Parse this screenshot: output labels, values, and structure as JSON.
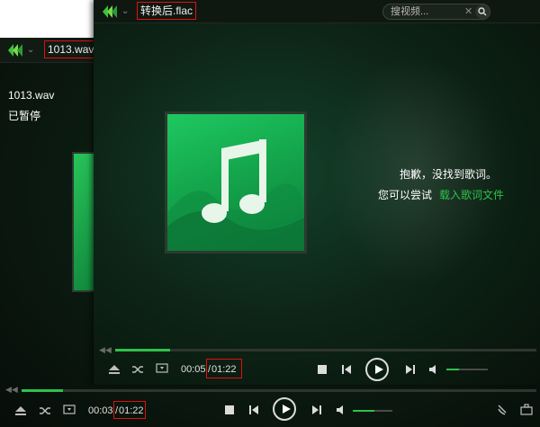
{
  "back_window": {
    "title": "1013.wav",
    "file_name": "1013.wav",
    "status": "已暂停",
    "current_time": "00:03",
    "total_time": "01:22",
    "progress": 0.08,
    "volume": 0.55
  },
  "front_window": {
    "title": "转换后.flac",
    "search": {
      "placeholder": "搜视频..."
    },
    "lyrics": {
      "message": "抱歉，没找到歌词。",
      "try_text": "您可以尝试",
      "load_link": "载入歌词文件"
    },
    "current_time": "00:05",
    "time_separator": "/",
    "total_time": "01:22",
    "progress": 0.13,
    "volume": 0.3
  },
  "colors": {
    "accent": "#2ec24a",
    "highlight_box": "#e01010",
    "album_green": "#1ec860"
  },
  "icons": [
    "logo-icon",
    "chevron-down-icon",
    "search-icon",
    "close-icon",
    "eject-icon",
    "shuffle-icon",
    "screen-icon",
    "stop-icon",
    "previous-icon",
    "play-icon",
    "next-icon",
    "volume-icon",
    "settings-icon",
    "toolbox-icon",
    "music-note-icon"
  ]
}
